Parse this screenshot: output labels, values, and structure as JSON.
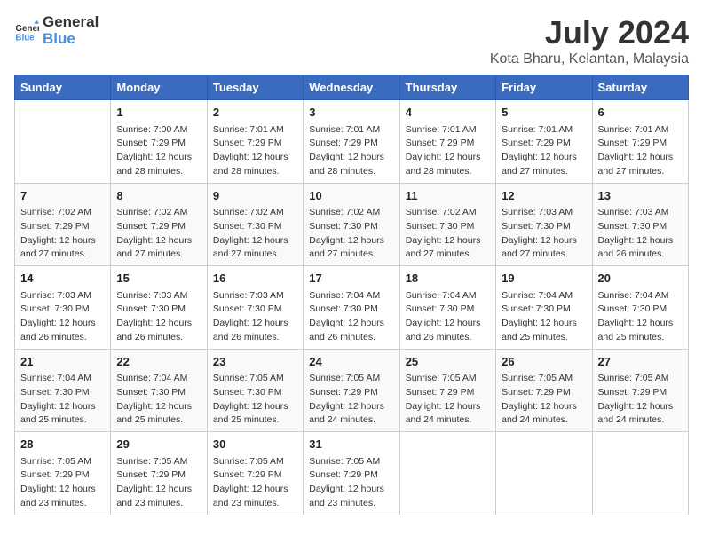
{
  "logo": {
    "text1": "General",
    "text2": "Blue"
  },
  "title": "July 2024",
  "location": "Kota Bharu, Kelantan, Malaysia",
  "days_header": [
    "Sunday",
    "Monday",
    "Tuesday",
    "Wednesday",
    "Thursday",
    "Friday",
    "Saturday"
  ],
  "weeks": [
    [
      {
        "day": "",
        "info": ""
      },
      {
        "day": "1",
        "info": "Sunrise: 7:00 AM\nSunset: 7:29 PM\nDaylight: 12 hours\nand 28 minutes."
      },
      {
        "day": "2",
        "info": "Sunrise: 7:01 AM\nSunset: 7:29 PM\nDaylight: 12 hours\nand 28 minutes."
      },
      {
        "day": "3",
        "info": "Sunrise: 7:01 AM\nSunset: 7:29 PM\nDaylight: 12 hours\nand 28 minutes."
      },
      {
        "day": "4",
        "info": "Sunrise: 7:01 AM\nSunset: 7:29 PM\nDaylight: 12 hours\nand 28 minutes."
      },
      {
        "day": "5",
        "info": "Sunrise: 7:01 AM\nSunset: 7:29 PM\nDaylight: 12 hours\nand 27 minutes."
      },
      {
        "day": "6",
        "info": "Sunrise: 7:01 AM\nSunset: 7:29 PM\nDaylight: 12 hours\nand 27 minutes."
      }
    ],
    [
      {
        "day": "7",
        "info": "Sunrise: 7:02 AM\nSunset: 7:29 PM\nDaylight: 12 hours\nand 27 minutes."
      },
      {
        "day": "8",
        "info": "Sunrise: 7:02 AM\nSunset: 7:29 PM\nDaylight: 12 hours\nand 27 minutes."
      },
      {
        "day": "9",
        "info": "Sunrise: 7:02 AM\nSunset: 7:30 PM\nDaylight: 12 hours\nand 27 minutes."
      },
      {
        "day": "10",
        "info": "Sunrise: 7:02 AM\nSunset: 7:30 PM\nDaylight: 12 hours\nand 27 minutes."
      },
      {
        "day": "11",
        "info": "Sunrise: 7:02 AM\nSunset: 7:30 PM\nDaylight: 12 hours\nand 27 minutes."
      },
      {
        "day": "12",
        "info": "Sunrise: 7:03 AM\nSunset: 7:30 PM\nDaylight: 12 hours\nand 27 minutes."
      },
      {
        "day": "13",
        "info": "Sunrise: 7:03 AM\nSunset: 7:30 PM\nDaylight: 12 hours\nand 26 minutes."
      }
    ],
    [
      {
        "day": "14",
        "info": "Sunrise: 7:03 AM\nSunset: 7:30 PM\nDaylight: 12 hours\nand 26 minutes."
      },
      {
        "day": "15",
        "info": "Sunrise: 7:03 AM\nSunset: 7:30 PM\nDaylight: 12 hours\nand 26 minutes."
      },
      {
        "day": "16",
        "info": "Sunrise: 7:03 AM\nSunset: 7:30 PM\nDaylight: 12 hours\nand 26 minutes."
      },
      {
        "day": "17",
        "info": "Sunrise: 7:04 AM\nSunset: 7:30 PM\nDaylight: 12 hours\nand 26 minutes."
      },
      {
        "day": "18",
        "info": "Sunrise: 7:04 AM\nSunset: 7:30 PM\nDaylight: 12 hours\nand 26 minutes."
      },
      {
        "day": "19",
        "info": "Sunrise: 7:04 AM\nSunset: 7:30 PM\nDaylight: 12 hours\nand 25 minutes."
      },
      {
        "day": "20",
        "info": "Sunrise: 7:04 AM\nSunset: 7:30 PM\nDaylight: 12 hours\nand 25 minutes."
      }
    ],
    [
      {
        "day": "21",
        "info": "Sunrise: 7:04 AM\nSunset: 7:30 PM\nDaylight: 12 hours\nand 25 minutes."
      },
      {
        "day": "22",
        "info": "Sunrise: 7:04 AM\nSunset: 7:30 PM\nDaylight: 12 hours\nand 25 minutes."
      },
      {
        "day": "23",
        "info": "Sunrise: 7:05 AM\nSunset: 7:30 PM\nDaylight: 12 hours\nand 25 minutes."
      },
      {
        "day": "24",
        "info": "Sunrise: 7:05 AM\nSunset: 7:29 PM\nDaylight: 12 hours\nand 24 minutes."
      },
      {
        "day": "25",
        "info": "Sunrise: 7:05 AM\nSunset: 7:29 PM\nDaylight: 12 hours\nand 24 minutes."
      },
      {
        "day": "26",
        "info": "Sunrise: 7:05 AM\nSunset: 7:29 PM\nDaylight: 12 hours\nand 24 minutes."
      },
      {
        "day": "27",
        "info": "Sunrise: 7:05 AM\nSunset: 7:29 PM\nDaylight: 12 hours\nand 24 minutes."
      }
    ],
    [
      {
        "day": "28",
        "info": "Sunrise: 7:05 AM\nSunset: 7:29 PM\nDaylight: 12 hours\nand 23 minutes."
      },
      {
        "day": "29",
        "info": "Sunrise: 7:05 AM\nSunset: 7:29 PM\nDaylight: 12 hours\nand 23 minutes."
      },
      {
        "day": "30",
        "info": "Sunrise: 7:05 AM\nSunset: 7:29 PM\nDaylight: 12 hours\nand 23 minutes."
      },
      {
        "day": "31",
        "info": "Sunrise: 7:05 AM\nSunset: 7:29 PM\nDaylight: 12 hours\nand 23 minutes."
      },
      {
        "day": "",
        "info": ""
      },
      {
        "day": "",
        "info": ""
      },
      {
        "day": "",
        "info": ""
      }
    ]
  ]
}
